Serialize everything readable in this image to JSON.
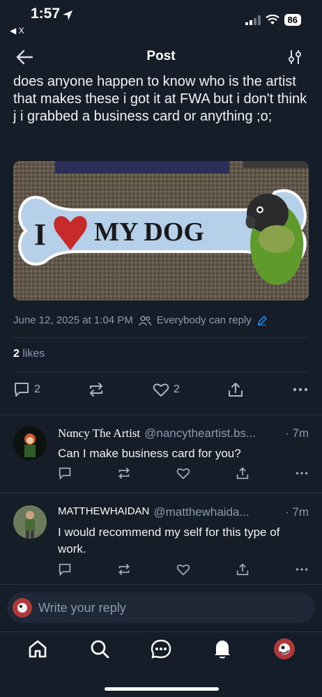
{
  "status": {
    "time": "1:57",
    "back_label": "◀ X",
    "battery": "86"
  },
  "header": {
    "title": "Post"
  },
  "post": {
    "text": "does anyone happen to know who is the artist that makes these i got it at FWA but i don't think j i grabbed a business card or anything ;o;",
    "image_text": {
      "left": "I",
      "right": "MY DOG"
    },
    "timestamp": "June 12, 2025 at 1:04 PM",
    "reply_setting": "Everybody can reply",
    "likes_count": "2",
    "likes_label": "likes",
    "reply_count": "2",
    "like_count": "2"
  },
  "replies": [
    {
      "name": "Nαncy Tɦe Artist",
      "handle": "@nancytheartist.bs...",
      "time": "· 7m",
      "text": "Can I make business card for you?"
    },
    {
      "name": "MATTHEWHAIDAN",
      "handle": "@matthewhaida...",
      "time": "· 7m",
      "text": "I would recommend my self for this type of work."
    }
  ],
  "composer": {
    "placeholder": "Write your reply"
  },
  "colors": {
    "background": "#151d28",
    "accent": "#1d8cf0",
    "muted": "#8a9bb0"
  }
}
